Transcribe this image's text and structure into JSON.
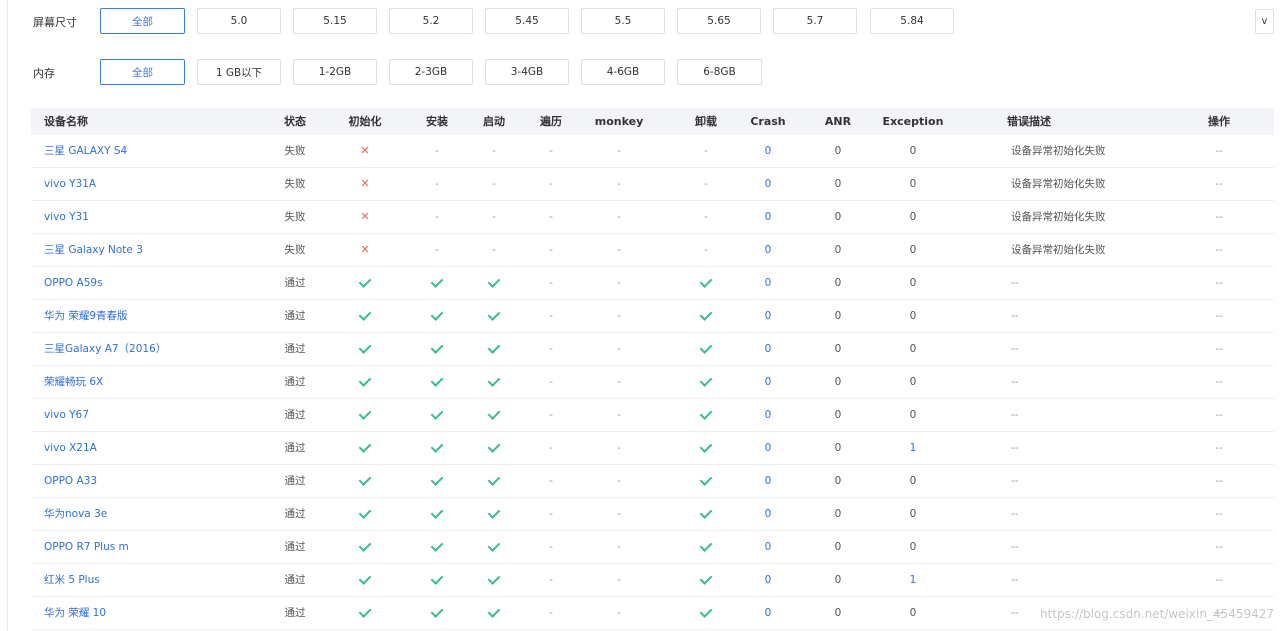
{
  "filters": {
    "screen": {
      "label": "屏幕尺寸",
      "options": [
        "全部",
        "5.0",
        "5.15",
        "5.2",
        "5.45",
        "5.5",
        "5.65",
        "5.7",
        "5.84"
      ],
      "selected": "全部",
      "expand_label": "v"
    },
    "memory": {
      "label": "内存",
      "options": [
        "全部",
        "1 GB以下",
        "1-2GB",
        "2-3GB",
        "3-4GB",
        "4-6GB",
        "6-8GB"
      ],
      "selected": "全部"
    }
  },
  "table": {
    "headers": [
      "设备名称",
      "状态",
      "初始化",
      "安装",
      "启动",
      "遍历",
      "monkey",
      "卸载",
      "Crash",
      "ANR",
      "Exception",
      "错误描述",
      "操作"
    ],
    "rows": [
      {
        "device": "三星 GALAXY S4",
        "status": "失败",
        "init": "x",
        "install": "-",
        "launch": "-",
        "traverse": "-",
        "monkey": "-",
        "uninstall": "-",
        "crash": "0",
        "anr": "0",
        "exception": "0",
        "error": "设备异常初始化失败",
        "action": "--"
      },
      {
        "device": "vivo Y31A",
        "status": "失败",
        "init": "x",
        "install": "-",
        "launch": "-",
        "traverse": "-",
        "monkey": "-",
        "uninstall": "-",
        "crash": "0",
        "anr": "0",
        "exception": "0",
        "error": "设备异常初始化失败",
        "action": "--"
      },
      {
        "device": "vivo Y31",
        "status": "失败",
        "init": "x",
        "install": "-",
        "launch": "-",
        "traverse": "-",
        "monkey": "-",
        "uninstall": "-",
        "crash": "0",
        "anr": "0",
        "exception": "0",
        "error": "设备异常初始化失败",
        "action": "--"
      },
      {
        "device": "三星 Galaxy Note 3",
        "status": "失败",
        "init": "x",
        "install": "-",
        "launch": "-",
        "traverse": "-",
        "monkey": "-",
        "uninstall": "-",
        "crash": "0",
        "anr": "0",
        "exception": "0",
        "error": "设备异常初始化失败",
        "action": "--"
      },
      {
        "device": "OPPO A59s",
        "status": "通过",
        "init": "ok",
        "install": "ok",
        "launch": "ok",
        "traverse": "-",
        "monkey": "-",
        "uninstall": "ok",
        "crash": "0",
        "anr": "0",
        "exception": "0",
        "error": "--",
        "action": "--"
      },
      {
        "device": "华为 荣耀9青春版",
        "status": "通过",
        "init": "ok",
        "install": "ok",
        "launch": "ok",
        "traverse": "-",
        "monkey": "-",
        "uninstall": "ok",
        "crash": "0",
        "anr": "0",
        "exception": "0",
        "error": "--",
        "action": "--"
      },
      {
        "device": "三星Galaxy A7（2016）",
        "status": "通过",
        "init": "ok",
        "install": "ok",
        "launch": "ok",
        "traverse": "-",
        "monkey": "-",
        "uninstall": "ok",
        "crash": "0",
        "anr": "0",
        "exception": "0",
        "error": "--",
        "action": "--"
      },
      {
        "device": "荣耀畅玩 6X",
        "status": "通过",
        "init": "ok",
        "install": "ok",
        "launch": "ok",
        "traverse": "-",
        "monkey": "-",
        "uninstall": "ok",
        "crash": "0",
        "anr": "0",
        "exception": "0",
        "error": "--",
        "action": "--"
      },
      {
        "device": "vivo Y67",
        "status": "通过",
        "init": "ok",
        "install": "ok",
        "launch": "ok",
        "traverse": "-",
        "monkey": "-",
        "uninstall": "ok",
        "crash": "0",
        "anr": "0",
        "exception": "0",
        "error": "--",
        "action": "--"
      },
      {
        "device": "vivo X21A",
        "status": "通过",
        "init": "ok",
        "install": "ok",
        "launch": "ok",
        "traverse": "-",
        "monkey": "-",
        "uninstall": "ok",
        "crash": "0",
        "anr": "0",
        "exception": "1",
        "error": "--",
        "action": "--"
      },
      {
        "device": "OPPO A33",
        "status": "通过",
        "init": "ok",
        "install": "ok",
        "launch": "ok",
        "traverse": "-",
        "monkey": "-",
        "uninstall": "ok",
        "crash": "0",
        "anr": "0",
        "exception": "0",
        "error": "--",
        "action": "--"
      },
      {
        "device": "华为nova 3e",
        "status": "通过",
        "init": "ok",
        "install": "ok",
        "launch": "ok",
        "traverse": "-",
        "monkey": "-",
        "uninstall": "ok",
        "crash": "0",
        "anr": "0",
        "exception": "0",
        "error": "--",
        "action": "--"
      },
      {
        "device": "OPPO R7 Plus m",
        "status": "通过",
        "init": "ok",
        "install": "ok",
        "launch": "ok",
        "traverse": "-",
        "monkey": "-",
        "uninstall": "ok",
        "crash": "0",
        "anr": "0",
        "exception": "0",
        "error": "--",
        "action": "--"
      },
      {
        "device": "红米 5 Plus",
        "status": "通过",
        "init": "ok",
        "install": "ok",
        "launch": "ok",
        "traverse": "-",
        "monkey": "-",
        "uninstall": "ok",
        "crash": "0",
        "anr": "0",
        "exception": "1",
        "error": "--",
        "action": "--"
      },
      {
        "device": "华为 荣耀 10",
        "status": "通过",
        "init": "ok",
        "install": "ok",
        "launch": "ok",
        "traverse": "-",
        "monkey": "-",
        "uninstall": "ok",
        "crash": "0",
        "anr": "0",
        "exception": "0",
        "error": "--",
        "action": "--"
      }
    ]
  },
  "watermark": "https://blog.csdn.net/weixin_45459427",
  "colors": {
    "accent": "#3a7cf1",
    "link": "#2e6fdc",
    "success": "#3bbd88",
    "fail": "#e8684a",
    "header_bg": "#f2f4f8"
  }
}
